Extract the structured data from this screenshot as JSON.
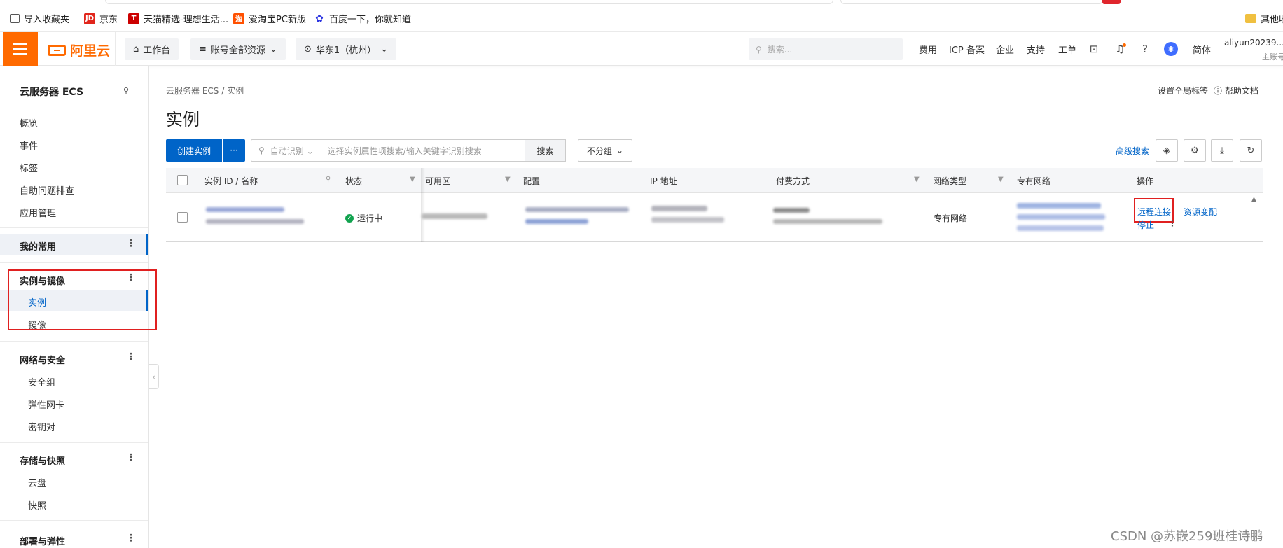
{
  "bookmarks": [
    {
      "label": "导入收藏夹",
      "icon": "import-icon",
      "color": "#555555"
    },
    {
      "label": "京东",
      "icon": "jd-icon",
      "color": "#e1251b"
    },
    {
      "label": "天猫精选-理想生活...",
      "icon": "tmall-icon",
      "color": "#cc0000"
    },
    {
      "label": "爱淘宝PC新版",
      "icon": "aitaobao-icon",
      "color": "#ff5000"
    },
    {
      "label": "百度一下，你就知道",
      "icon": "baidu-icon",
      "color": "#2932e1"
    },
    {
      "label": "其他收",
      "icon": "folder-icon",
      "color": "#f0c040"
    }
  ],
  "topnav": {
    "logo": "阿里云",
    "workbench": "工作台",
    "resource": "账号全部资源",
    "region": "华东1（杭州）",
    "search_placeholder": "搜索...",
    "links": [
      "费用",
      "ICP 备案",
      "企业",
      "支持",
      "工单"
    ],
    "lang": "简体",
    "user": "aliyun20239...",
    "user_role": "主账号",
    "accent": "#ff6a00"
  },
  "sidebar": {
    "title": "云服务器 ECS",
    "top_items": [
      "概览",
      "事件",
      "标签",
      "自助问题排查",
      "应用管理"
    ],
    "favorites": "我的常用",
    "groups": [
      {
        "label": "实例与镜像",
        "items": [
          "实例",
          "镜像"
        ]
      },
      {
        "label": "网络与安全",
        "items": [
          "安全组",
          "弹性网卡",
          "密钥对"
        ]
      },
      {
        "label": "存储与快照",
        "items": [
          "云盘",
          "快照"
        ]
      },
      {
        "label": "部署与弹性",
        "items": []
      }
    ],
    "active_item": "实例"
  },
  "main": {
    "breadcrumb": "云服务器 ECS  /  实例",
    "title": "实例",
    "global_tags": "设置全局标签",
    "help_docs": "帮助文档",
    "create_button": "创建实例",
    "more_button": "···",
    "search_mode": "自动识别",
    "search_placeholder": "选择实例属性项搜索/输入关键字识别搜索",
    "search_button": "搜索",
    "group_select": "不分组",
    "advanced_search": "高级搜索"
  },
  "table": {
    "columns": [
      "实例 ID / 名称",
      "状态",
      "可用区",
      "配置",
      "IP 地址",
      "付费方式",
      "网络类型",
      "专有网络",
      "操作"
    ],
    "rows": [
      {
        "status": "运行中",
        "network_type": "专有网络",
        "actions": [
          "远程连接",
          "资源变配",
          "停止"
        ]
      }
    ]
  },
  "watermark": "CSDN @苏嵌259班桂诗鹏"
}
